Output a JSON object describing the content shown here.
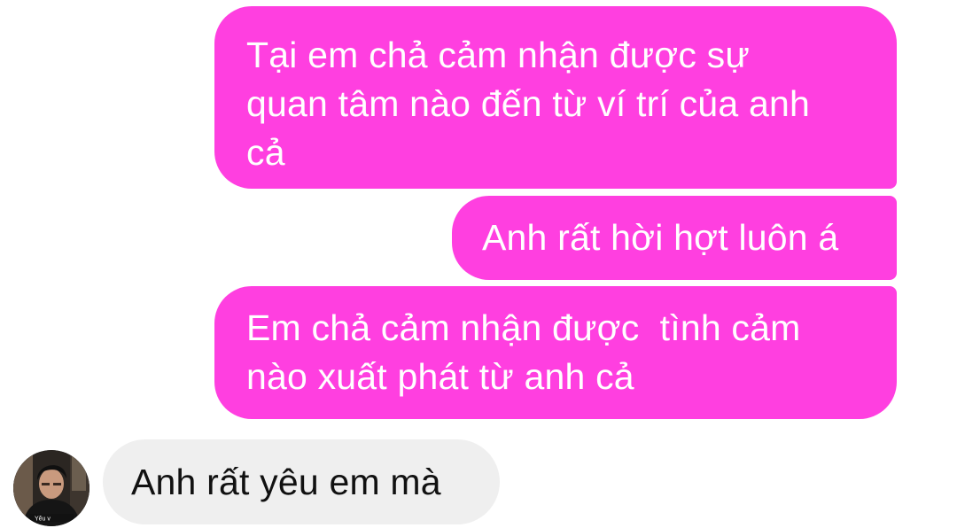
{
  "colors": {
    "outgoing_bubble": "#ff3fe0",
    "incoming_bubble": "#efefef",
    "outgoing_text": "#ffffff",
    "incoming_text": "#111111"
  },
  "messages": [
    {
      "direction": "outgoing",
      "text": "Tại em chả cảm nhận được sự\nquan tâm nào đến từ ví trí của anh\ncả"
    },
    {
      "direction": "outgoing",
      "text": "Anh rất hời hợt luôn á"
    },
    {
      "direction": "outgoing",
      "text": "Em chả cảm nhận được  tình cảm\nnào xuất phát từ anh cả"
    },
    {
      "direction": "incoming",
      "text": "Anh rất yêu em mà"
    }
  ],
  "sender_avatar": {
    "icon": "profile-photo-icon",
    "caption": "Yêu v"
  }
}
